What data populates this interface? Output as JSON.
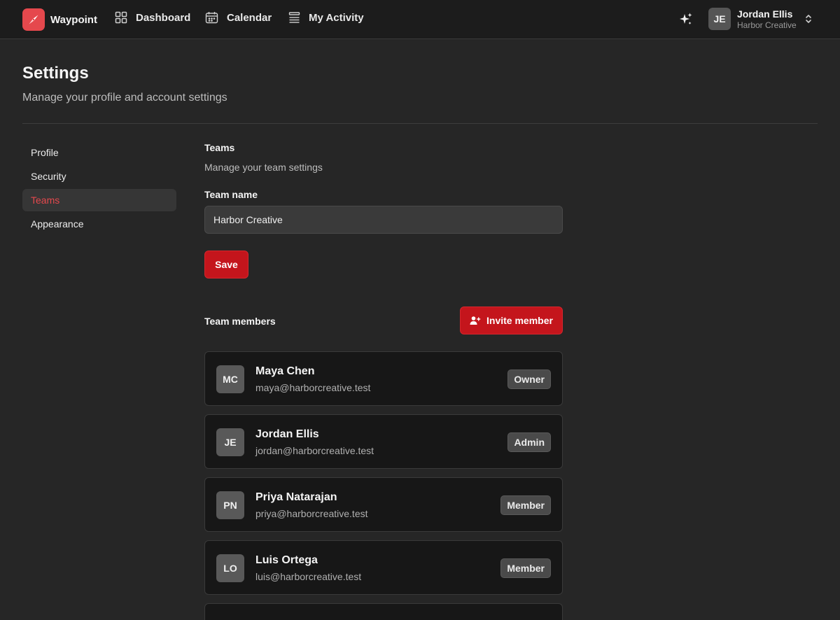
{
  "app": {
    "name": "Waypoint",
    "accent_color": "#e5484d",
    "button_color": "#c4151c"
  },
  "nav": {
    "items": [
      {
        "label": "Dashboard",
        "icon": "grid-icon"
      },
      {
        "label": "Calendar",
        "icon": "calendar-icon"
      },
      {
        "label": "My Activity",
        "icon": "list-icon"
      }
    ]
  },
  "user": {
    "initials": "JE",
    "name": "Jordan Ellis",
    "org": "Harbor Creative"
  },
  "header": {
    "title": "Settings",
    "subtitle": "Manage your profile and account settings"
  },
  "sidebar": {
    "items": [
      {
        "label": "Profile",
        "active": false
      },
      {
        "label": "Security",
        "active": false
      },
      {
        "label": "Teams",
        "active": true
      },
      {
        "label": "Appearance",
        "active": false
      }
    ]
  },
  "teams": {
    "title": "Teams",
    "description": "Manage your team settings",
    "team_name_label": "Team name",
    "team_name_value": "Harbor Creative",
    "save_label": "Save",
    "members_title": "Team members",
    "invite_label": "Invite member",
    "members": [
      {
        "initials": "MC",
        "name": "Maya Chen",
        "email": "maya@harborcreative.test",
        "role": "Owner"
      },
      {
        "initials": "JE",
        "name": "Jordan Ellis",
        "email": "jordan@harborcreative.test",
        "role": "Admin"
      },
      {
        "initials": "PN",
        "name": "Priya Natarajan",
        "email": "priya@harborcreative.test",
        "role": "Member"
      },
      {
        "initials": "LO",
        "name": "Luis Ortega",
        "email": "luis@harborcreative.test",
        "role": "Member"
      }
    ]
  }
}
